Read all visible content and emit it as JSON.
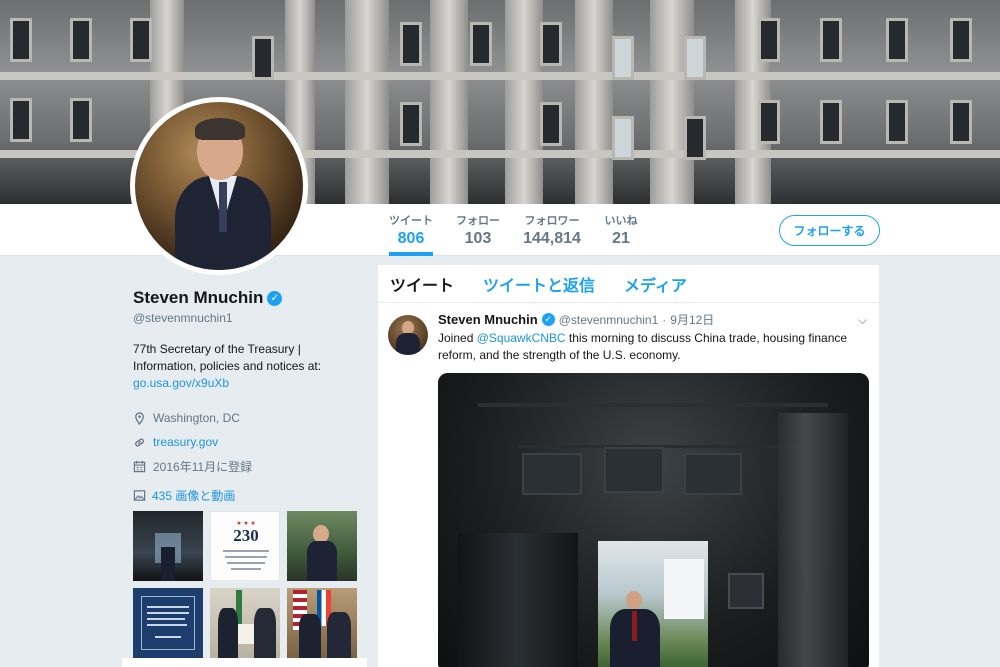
{
  "nav": {
    "stats": [
      {
        "label": "ツイート",
        "value": "806"
      },
      {
        "label": "フォロー",
        "value": "103"
      },
      {
        "label": "フォロワー",
        "value": "144,814"
      },
      {
        "label": "いいね",
        "value": "21"
      }
    ],
    "follow_label": "フォローする"
  },
  "profile": {
    "name": "Steven Mnuchin",
    "verified_mark": "✓",
    "handle": "@stevenmnuchin1",
    "bio": "77th Secretary of the Treasury | Information, policies and notices at:",
    "bio_link": "go.usa.gov/x9uXb",
    "location": "Washington, DC",
    "website": "treasury.gov",
    "joined": "2016年11月に登録",
    "media_count": "435 画像と動画"
  },
  "thumbs": {
    "t2_number": "230",
    "t2_stars": "★ ★ ★"
  },
  "timeline": {
    "tabs": [
      "ツイート",
      "ツイートと返信",
      "メディア"
    ]
  },
  "tweet": {
    "name": "Steven Mnuchin",
    "handle": "@stevenmnuchin1",
    "separator": "·",
    "date": "9月12日",
    "text_before": "Joined ",
    "mention": "@SquawkCNBC",
    "text_after": " this morning to discuss China trade, housing finance reform, and the strength of the U.S. economy.",
    "caret": "⌵"
  },
  "colors": {
    "accent": "#1da1f2",
    "link": "#1b95e0",
    "muted": "#657786",
    "background": "#e6ecf0"
  },
  "icons": [
    "location-icon",
    "link-icon",
    "calendar-icon",
    "image-icon",
    "verified-badge-icon",
    "chevron-down-icon"
  ]
}
